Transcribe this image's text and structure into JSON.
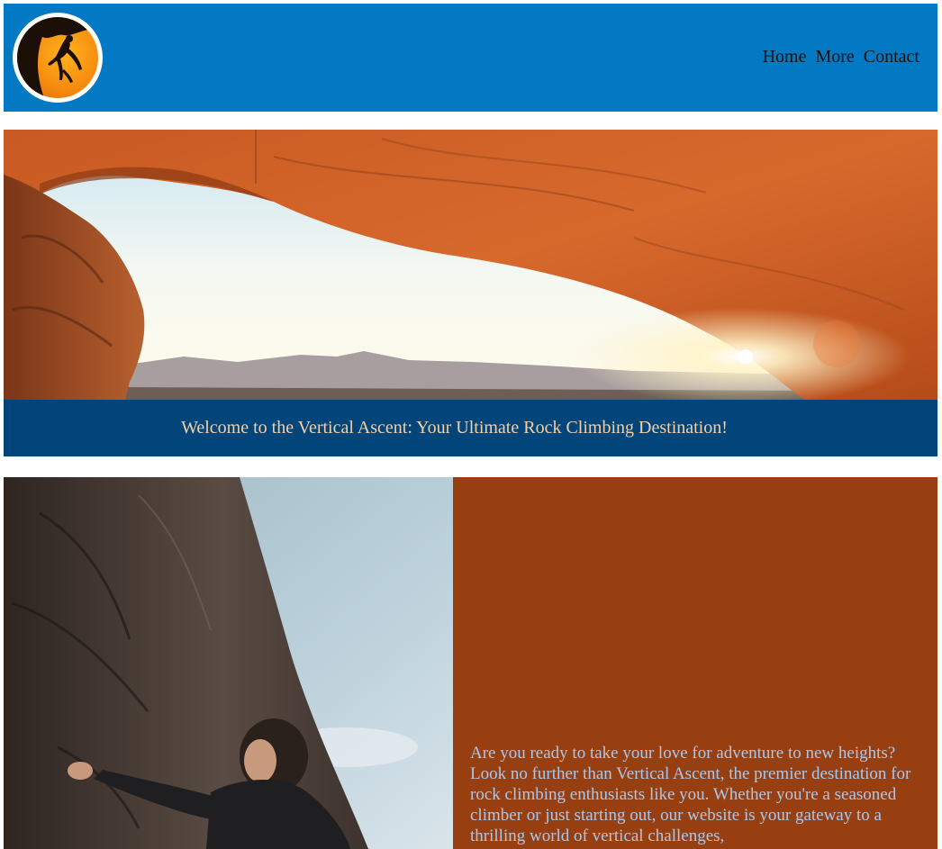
{
  "header": {
    "logo_name": "vertical-ascent-logo",
    "nav": [
      {
        "label": "Home"
      },
      {
        "label": "More"
      },
      {
        "label": "Contact"
      }
    ],
    "background": "#0378c3"
  },
  "hero": {
    "image_subject": "red sandstone arch at sunrise",
    "banner_text": "Welcome to the Vertical Ascent: Your Ultimate Rock Climbing Destination!",
    "banner_color": "#02457a",
    "banner_text_color": "#f3d0a8"
  },
  "content": {
    "image_subject": "woman climbing a rock face",
    "intro_text": "Are you ready to take your love for adventure to new heights? Look no further than Vertical Ascent, the premier destination for rock climbing enthusiasts like you. Whether you're a seasoned climber or just starting out, our website is your gateway to a thrilling world of vertical challenges,",
    "panel_color": "#973f10",
    "text_color": "#a9c8ec"
  }
}
